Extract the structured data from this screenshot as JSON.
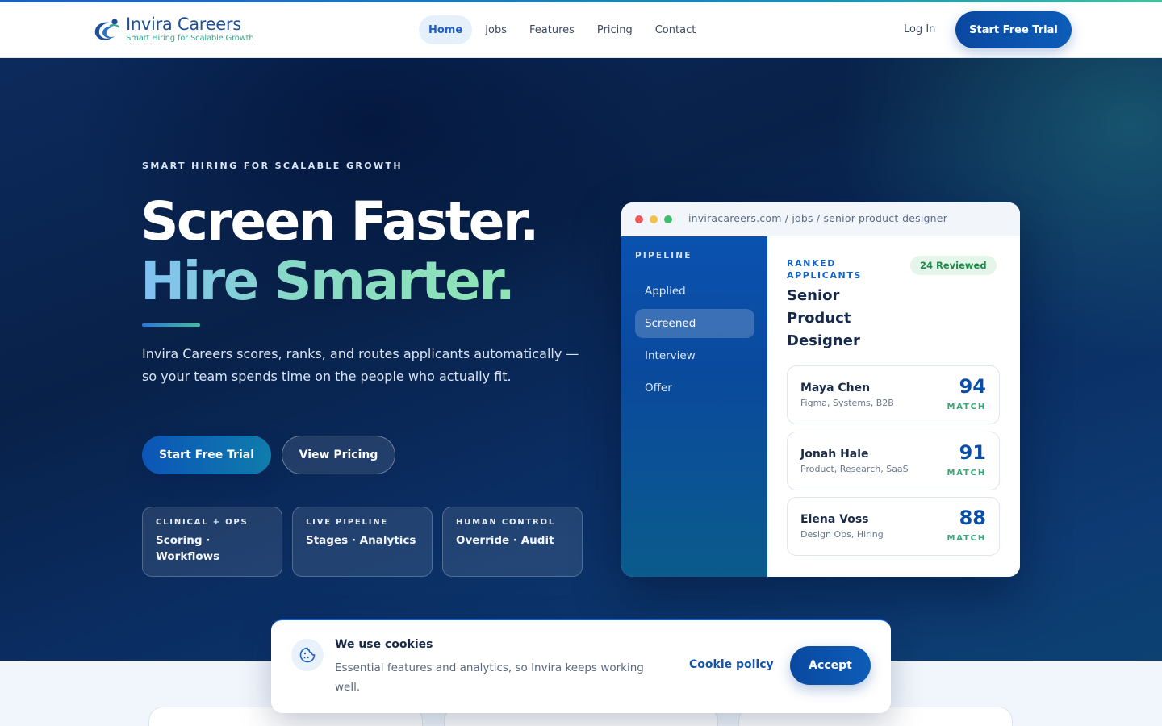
{
  "brand": {
    "name": "Invira Careers",
    "tagline": "Smart Hiring for Scalable Growth"
  },
  "nav": {
    "links": [
      {
        "label": "Home",
        "active": true
      },
      {
        "label": "Jobs",
        "active": false
      },
      {
        "label": "Features",
        "active": false
      },
      {
        "label": "Pricing",
        "active": false
      },
      {
        "label": "Contact",
        "active": false
      }
    ],
    "login_label": "Log In",
    "cta_label": "Start Free Trial"
  },
  "hero": {
    "eyebrow": "SMART HIRING FOR SCALABLE GROWTH",
    "headline_line1": "Screen Faster.",
    "headline_line2": "Hire Smarter.",
    "lede": "Invira Careers scores, ranks, and routes applicants automatically — so your team spends time on the people who actually fit.",
    "primary_cta": "Start Free Trial",
    "secondary_cta": "View Pricing",
    "features": [
      {
        "label": "CLINICAL + OPS",
        "text": "Scoring · Workflows"
      },
      {
        "label": "LIVE PIPELINE",
        "text": "Stages · Analytics"
      },
      {
        "label": "HUMAN CONTROL",
        "text": "Override · Audit"
      }
    ]
  },
  "mockup": {
    "url": "inviracareers.com / jobs / senior-product-designer",
    "pipeline_title": "PIPELINE",
    "stages": [
      {
        "label": "Applied",
        "active": false
      },
      {
        "label": "Screened",
        "active": true
      },
      {
        "label": "Interview",
        "active": false
      },
      {
        "label": "Offer",
        "active": false
      }
    ],
    "ranked_label": "RANKED APPLICANTS",
    "reviewed_badge": "24 Reviewed",
    "job_title": "Senior Product Designer",
    "candidates": [
      {
        "name": "Maya Chen",
        "skills": "Figma, Systems, B2B",
        "score": "94",
        "match_label": "MATCH"
      },
      {
        "name": "Jonah Hale",
        "skills": "Product, Research, SaaS",
        "score": "91",
        "match_label": "MATCH"
      },
      {
        "name": "Elena Voss",
        "skills": "Design Ops, Hiring",
        "score": "88",
        "match_label": "MATCH"
      }
    ]
  },
  "cookie": {
    "title": "We use cookies",
    "text": "Essential features and analytics, so Invira keeps working well.",
    "policy_link": "Cookie policy",
    "accept_label": "Accept"
  },
  "colors": {
    "brand_blue": "#0a48a0",
    "hero_navy": "#082149",
    "accent_green": "#35a878",
    "window_dot_red": "#ef5a5a",
    "window_dot_yellow": "#f2c14a",
    "window_dot_green": "#3fbf6e"
  }
}
